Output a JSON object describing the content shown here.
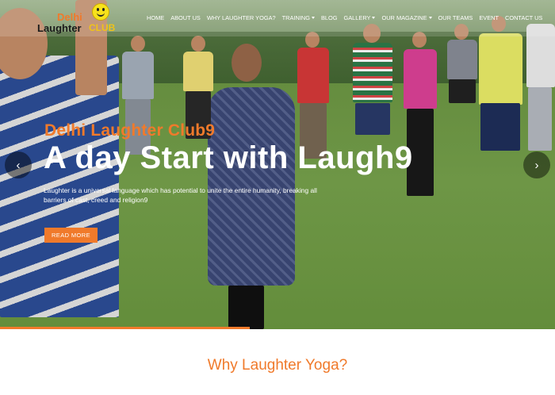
{
  "logo": {
    "line1": "Delhi",
    "line2": "Laughter",
    "line3": "CLUB"
  },
  "nav": [
    {
      "label": "HOME"
    },
    {
      "label": "ABOUT US"
    },
    {
      "label": "WHY LAUGHTER YOGA?"
    },
    {
      "label": "TRAINING",
      "dropdown": true
    },
    {
      "label": "BLOG"
    },
    {
      "label": "GALLERY",
      "dropdown": true
    },
    {
      "label": "OUR MAGAZINE",
      "dropdown": true
    },
    {
      "label": "OUR TEAMS"
    },
    {
      "label": "EVENT"
    },
    {
      "label": "CONTACT US"
    }
  ],
  "hero": {
    "subtitle": "Delhi Laughter Club9",
    "title": "A day Start with Laugh9",
    "description": "Laughter is a universal language which has potential to unite the entire humanity, breaking all barriers of cast, creed and religion9",
    "button": "READ MORE",
    "prev_icon": "chevron-left-icon",
    "next_icon": "chevron-right-icon",
    "progress": 0.45
  },
  "section": {
    "title": "Why Laughter Yoga?"
  },
  "colors": {
    "accent": "#f07a2b",
    "white": "#ffffff"
  }
}
